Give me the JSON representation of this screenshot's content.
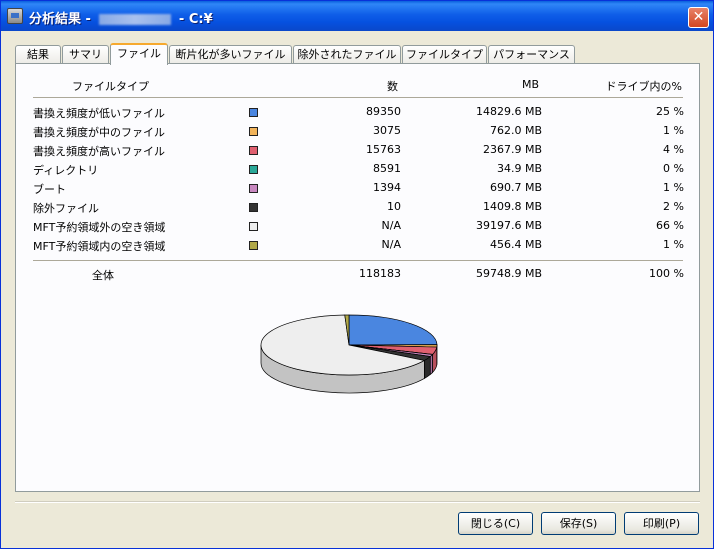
{
  "window": {
    "title_prefix": "分析結果 -",
    "title_suffix": "- C:¥",
    "close_glyph": "✕"
  },
  "tabs": [
    {
      "label": "結果"
    },
    {
      "label": "サマリ"
    },
    {
      "label": "ファイル",
      "active": true
    },
    {
      "label": "断片化が多いファイル"
    },
    {
      "label": "除外されたファイル"
    },
    {
      "label": "ファイルタイプ"
    },
    {
      "label": "パフォーマンス"
    }
  ],
  "table": {
    "headers": {
      "type": "ファイルタイプ",
      "count": "数",
      "mb": "MB",
      "pct": "ドライブ内の%"
    },
    "rows": [
      {
        "name": "書換え頻度が低いファイル",
        "color": "#4a86e0",
        "count": "89350",
        "mb": "14829.6 MB",
        "pct": "25 %",
        "share": 25
      },
      {
        "name": "書換え頻度が中のファイル",
        "color": "#f2b45a",
        "count": "3075",
        "mb": "762.0 MB",
        "pct": "1 %",
        "share": 1
      },
      {
        "name": "書換え頻度が高いファイル",
        "color": "#e06070",
        "count": "15763",
        "mb": "2367.9 MB",
        "pct": "4 %",
        "share": 4
      },
      {
        "name": "ディレクトリ",
        "color": "#2aa898",
        "count": "8591",
        "mb": "34.9 MB",
        "pct": "0 %",
        "share": 0
      },
      {
        "name": "ブート",
        "color": "#c888c0",
        "count": "1394",
        "mb": "690.7 MB",
        "pct": "1 %",
        "share": 1
      },
      {
        "name": "除外ファイル",
        "color": "#333333",
        "count": "10",
        "mb": "1409.8 MB",
        "pct": "2 %",
        "share": 2
      },
      {
        "name": "MFT予約領域外の空き領域",
        "color": "#eeeeee",
        "count": "N/A",
        "mb": "39197.6 MB",
        "pct": "66 %",
        "share": 66
      },
      {
        "name": "MFT予約領域内の空き領域",
        "color": "#b0a848",
        "count": "N/A",
        "mb": "456.4 MB",
        "pct": "1 %",
        "share": 1
      }
    ],
    "total": {
      "name": "全体",
      "count": "118183",
      "mb": "59748.9 MB",
      "pct": "100 %"
    }
  },
  "buttons": {
    "close": "閉じる(C)",
    "save": "保存(S)",
    "print": "印刷(P)"
  }
}
